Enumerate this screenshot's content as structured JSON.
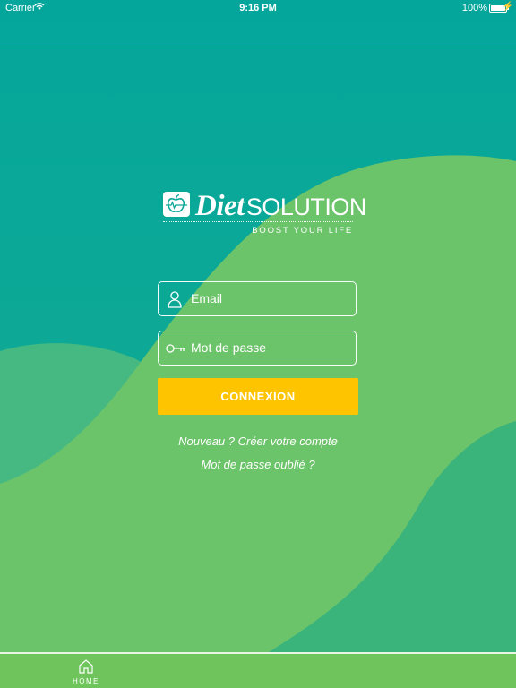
{
  "status_bar": {
    "carrier": "Carrier",
    "time": "9:16 PM",
    "battery_percent": "100%",
    "wifi_icon": "wifi-icon",
    "battery_icon": "battery-icon",
    "charging_icon": "charging-bolt-icon"
  },
  "logo": {
    "diet": "Diet",
    "solution": "SOLUTION",
    "tagline": "BOOST YOUR LIFE",
    "icon": "apple-heartbeat-icon"
  },
  "login_form": {
    "email_placeholder": "Email",
    "email_value": "",
    "email_icon": "user-icon",
    "password_placeholder": "Mot de passe",
    "password_value": "",
    "password_icon": "key-icon",
    "submit_label": "CONNEXION"
  },
  "links": {
    "signup": "Nouveau ? Créer votre compte",
    "forgot_password": "Mot de passe oublié ?"
  },
  "tab_bar": {
    "items": [
      {
        "label": "HOME",
        "icon": "home-icon"
      }
    ]
  },
  "colors": {
    "background_teal": "#0ea89a",
    "wave_green": "#6cc46a",
    "button_yellow": "#ffc400",
    "tab_bar_green": "#70c45c"
  }
}
